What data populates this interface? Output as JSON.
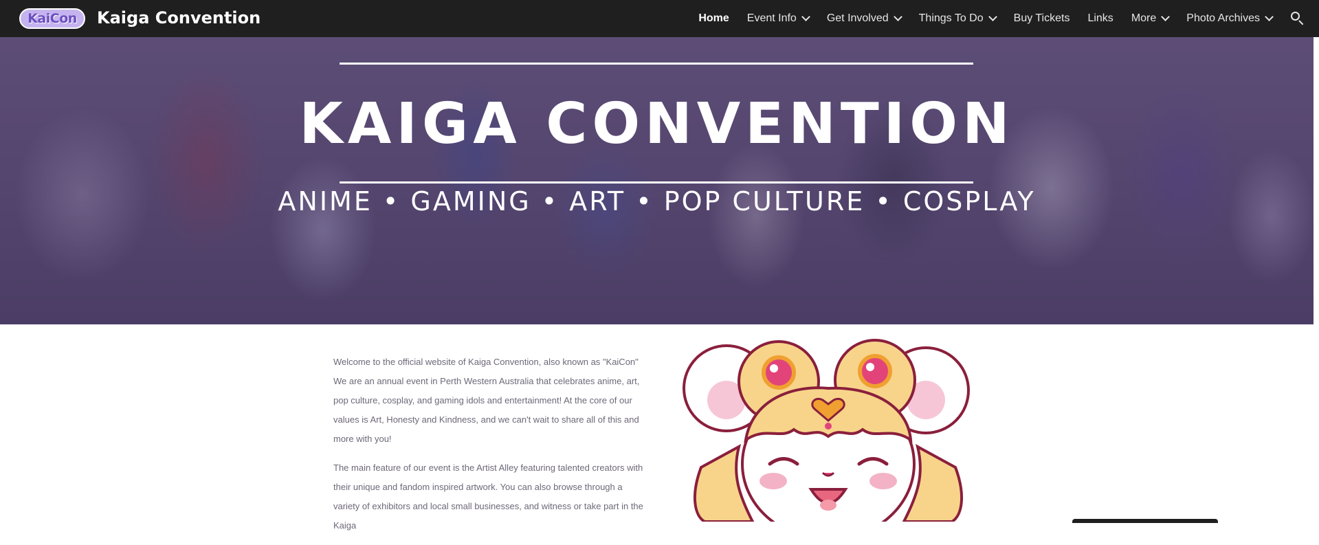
{
  "header": {
    "logo_text": "KaiCon",
    "site_title": "Kaiga Convention"
  },
  "nav": {
    "items": [
      {
        "label": "Home",
        "active": true,
        "dropdown": false
      },
      {
        "label": "Event Info",
        "active": false,
        "dropdown": true
      },
      {
        "label": "Get Involved",
        "active": false,
        "dropdown": true
      },
      {
        "label": "Things To Do",
        "active": false,
        "dropdown": true
      },
      {
        "label": "Buy Tickets",
        "active": false,
        "dropdown": false
      },
      {
        "label": "Links",
        "active": false,
        "dropdown": false
      },
      {
        "label": "More",
        "active": false,
        "dropdown": true
      },
      {
        "label": "Photo Archives",
        "active": false,
        "dropdown": true
      }
    ],
    "search_icon": "search-icon"
  },
  "hero": {
    "title": "KAIGA CONVENTION",
    "subtitle": "ANIME • GAMING • ART • POP CULTURE • COSPLAY"
  },
  "intro": {
    "paragraph_1": "Welcome to the official website of Kaiga Convention, also known as \"KaiCon\" We are an annual event in Perth Western Australia that celebrates anime, art, pop culture, cosplay, and gaming idols and entertainment! At the core of our values is Art, Honesty and Kindness, and we can't wait to share all of this and more with you!",
    "paragraph_2": "The main feature of our event is the Artist Alley featuring talented creators with their unique and fandom inspired artwork. You can also browse through a variety of exhibitors and local small businesses, and witness or take part in the Kaiga"
  },
  "colors": {
    "topbar": "#1f1f1f",
    "hero_tint": "#5e5076",
    "body_text": "#6d6878",
    "mascot_outline": "#8a1f3c",
    "mascot_hair": "#f7d48a",
    "mascot_gem": "#e2447a"
  }
}
